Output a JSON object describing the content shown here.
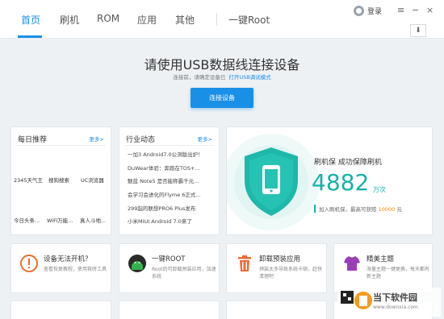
{
  "nav": {
    "tabs": [
      {
        "label": "首页",
        "active": true
      },
      {
        "label": "刷机"
      },
      {
        "label": "ROM"
      },
      {
        "label": "应用"
      },
      {
        "label": "其他"
      },
      {
        "label": "一键Root"
      }
    ],
    "login": "登录",
    "menu_glyph": "≡",
    "minimize_glyph": "−",
    "close_glyph": "×",
    "download_glyph": "⬇"
  },
  "connect": {
    "title": "请使用USB数据线连接设备",
    "hint": "连接前，请确定设备已",
    "hint_link": "打开USB调试模式",
    "button": "连接设备"
  },
  "daily": {
    "title": "每日推荐",
    "more": "更多>",
    "apps": [
      "2345天气王",
      "搜狗搜索",
      "UC浏览器",
      "今日头条...",
      "WiFi万能...",
      "真人斗地..."
    ]
  },
  "news": {
    "title": "行业动态",
    "more": "更多>",
    "items": [
      "一加3 Android7.0公测版出炉！",
      "DuWear体验：奔跑在TOS+...",
      "魅蓝 Note5 是否能称霸千元...",
      "会学习会进化的Flyme 6正式...",
      "299起的联想PRO6 Plus发布",
      "小米MIUI Android 7.0来了"
    ]
  },
  "promo": {
    "title": "刷机保  成功保障刷机",
    "count": "4882",
    "unit": "万次",
    "sub_prefix": "加入刷机保，最高可获赔",
    "amount": "10000",
    "sub_suffix": "元",
    "accent": "#15b2a8"
  },
  "tools": [
    {
      "title": "设备无法开机？",
      "desc": "查看恢复教程，使用救砖工具",
      "icon": "alert-icon",
      "color": "#f26b2c"
    },
    {
      "title": "一键ROOT",
      "desc": "Root后可卸载预装应用，加速系统",
      "icon": "android-root-icon",
      "color": "#1e9a4a"
    },
    {
      "title": "卸载预装应用",
      "desc": "预装太多导致系统卡顿，赶快清理吧",
      "icon": "trash-icon",
      "color": "#f06a35"
    },
    {
      "title": "精美主题",
      "desc": "海量主题一键更换，每天都有新主题",
      "icon": "tshirt-icon",
      "color": "#9b3fb6"
    }
  ],
  "watermark": {
    "name": "当下软件园",
    "url": "www.downxia.com"
  },
  "colors": {
    "accent": "#1a8fe6",
    "teal": "#15b2a8",
    "orange": "#f08a00"
  }
}
